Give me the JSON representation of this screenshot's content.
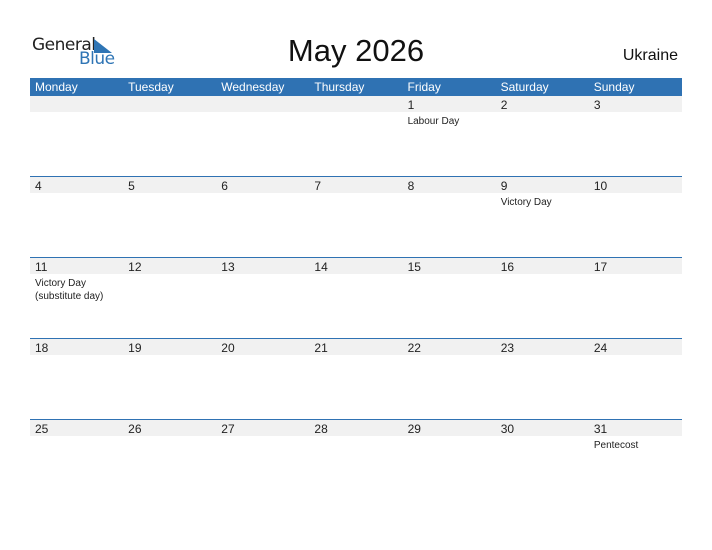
{
  "logo": {
    "general": "General",
    "blue": "Blue",
    "accent": "#2f75b5"
  },
  "title": "May 2026",
  "country": "Ukraine",
  "weekdays": [
    "Monday",
    "Tuesday",
    "Wednesday",
    "Thursday",
    "Friday",
    "Saturday",
    "Sunday"
  ],
  "weeks": [
    [
      {
        "day": "",
        "event": ""
      },
      {
        "day": "",
        "event": ""
      },
      {
        "day": "",
        "event": ""
      },
      {
        "day": "",
        "event": ""
      },
      {
        "day": "1",
        "event": "Labour Day"
      },
      {
        "day": "2",
        "event": ""
      },
      {
        "day": "3",
        "event": ""
      }
    ],
    [
      {
        "day": "4",
        "event": ""
      },
      {
        "day": "5",
        "event": ""
      },
      {
        "day": "6",
        "event": ""
      },
      {
        "day": "7",
        "event": ""
      },
      {
        "day": "8",
        "event": ""
      },
      {
        "day": "9",
        "event": "Victory Day"
      },
      {
        "day": "10",
        "event": ""
      }
    ],
    [
      {
        "day": "11",
        "event": "Victory Day (substitute day)"
      },
      {
        "day": "12",
        "event": ""
      },
      {
        "day": "13",
        "event": ""
      },
      {
        "day": "14",
        "event": ""
      },
      {
        "day": "15",
        "event": ""
      },
      {
        "day": "16",
        "event": ""
      },
      {
        "day": "17",
        "event": ""
      }
    ],
    [
      {
        "day": "18",
        "event": ""
      },
      {
        "day": "19",
        "event": ""
      },
      {
        "day": "20",
        "event": ""
      },
      {
        "day": "21",
        "event": ""
      },
      {
        "day": "22",
        "event": ""
      },
      {
        "day": "23",
        "event": ""
      },
      {
        "day": "24",
        "event": ""
      }
    ],
    [
      {
        "day": "25",
        "event": ""
      },
      {
        "day": "26",
        "event": ""
      },
      {
        "day": "27",
        "event": ""
      },
      {
        "day": "28",
        "event": ""
      },
      {
        "day": "29",
        "event": ""
      },
      {
        "day": "30",
        "event": ""
      },
      {
        "day": "31",
        "event": "Pentecost"
      }
    ]
  ],
  "colors": {
    "header": "#2f72b3",
    "band": "#f1f1f1"
  }
}
